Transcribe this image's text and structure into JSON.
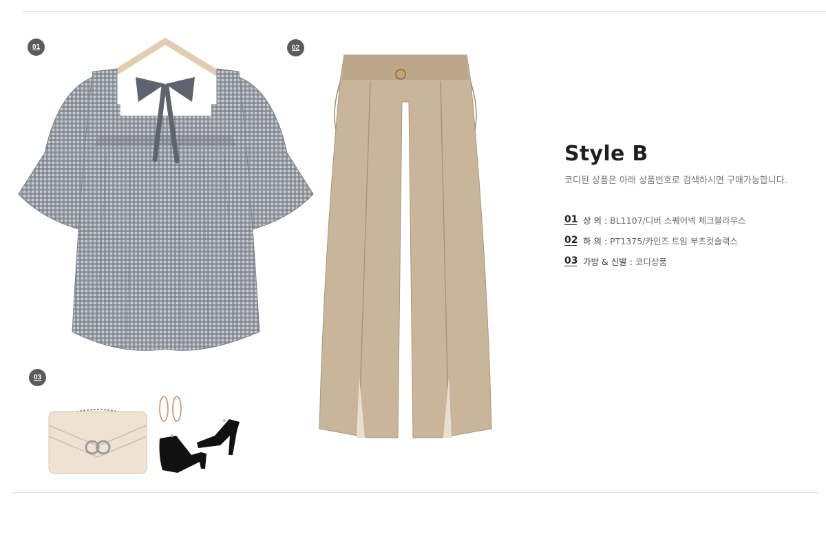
{
  "badges": [
    "01",
    "02",
    "03"
  ],
  "style_info": {
    "title": "Style B",
    "description": "코디된 상품은 아래 상품번호로 검색하시면 구매가능합니다.",
    "items": [
      {
        "num": "01",
        "label": "상 의 :",
        "value": "BL1107/디버 스퀘어넥 체크블라우스"
      },
      {
        "num": "02",
        "label": "하 의 :",
        "value": "PT1375/카인즈 트임 부츠컷슬랙스"
      },
      {
        "num": "03",
        "label": "가방 & 신발  :",
        "value": "코디상품"
      }
    ]
  },
  "colors": {
    "badge": "#5b5b5b",
    "blouse": "#8b9099",
    "pants": "#c9b59a",
    "bag": "#efe2d2",
    "shoes": "#111111"
  },
  "icons": [
    "blouse-image",
    "pants-image",
    "bag-image",
    "earrings-image",
    "sandals-image"
  ]
}
